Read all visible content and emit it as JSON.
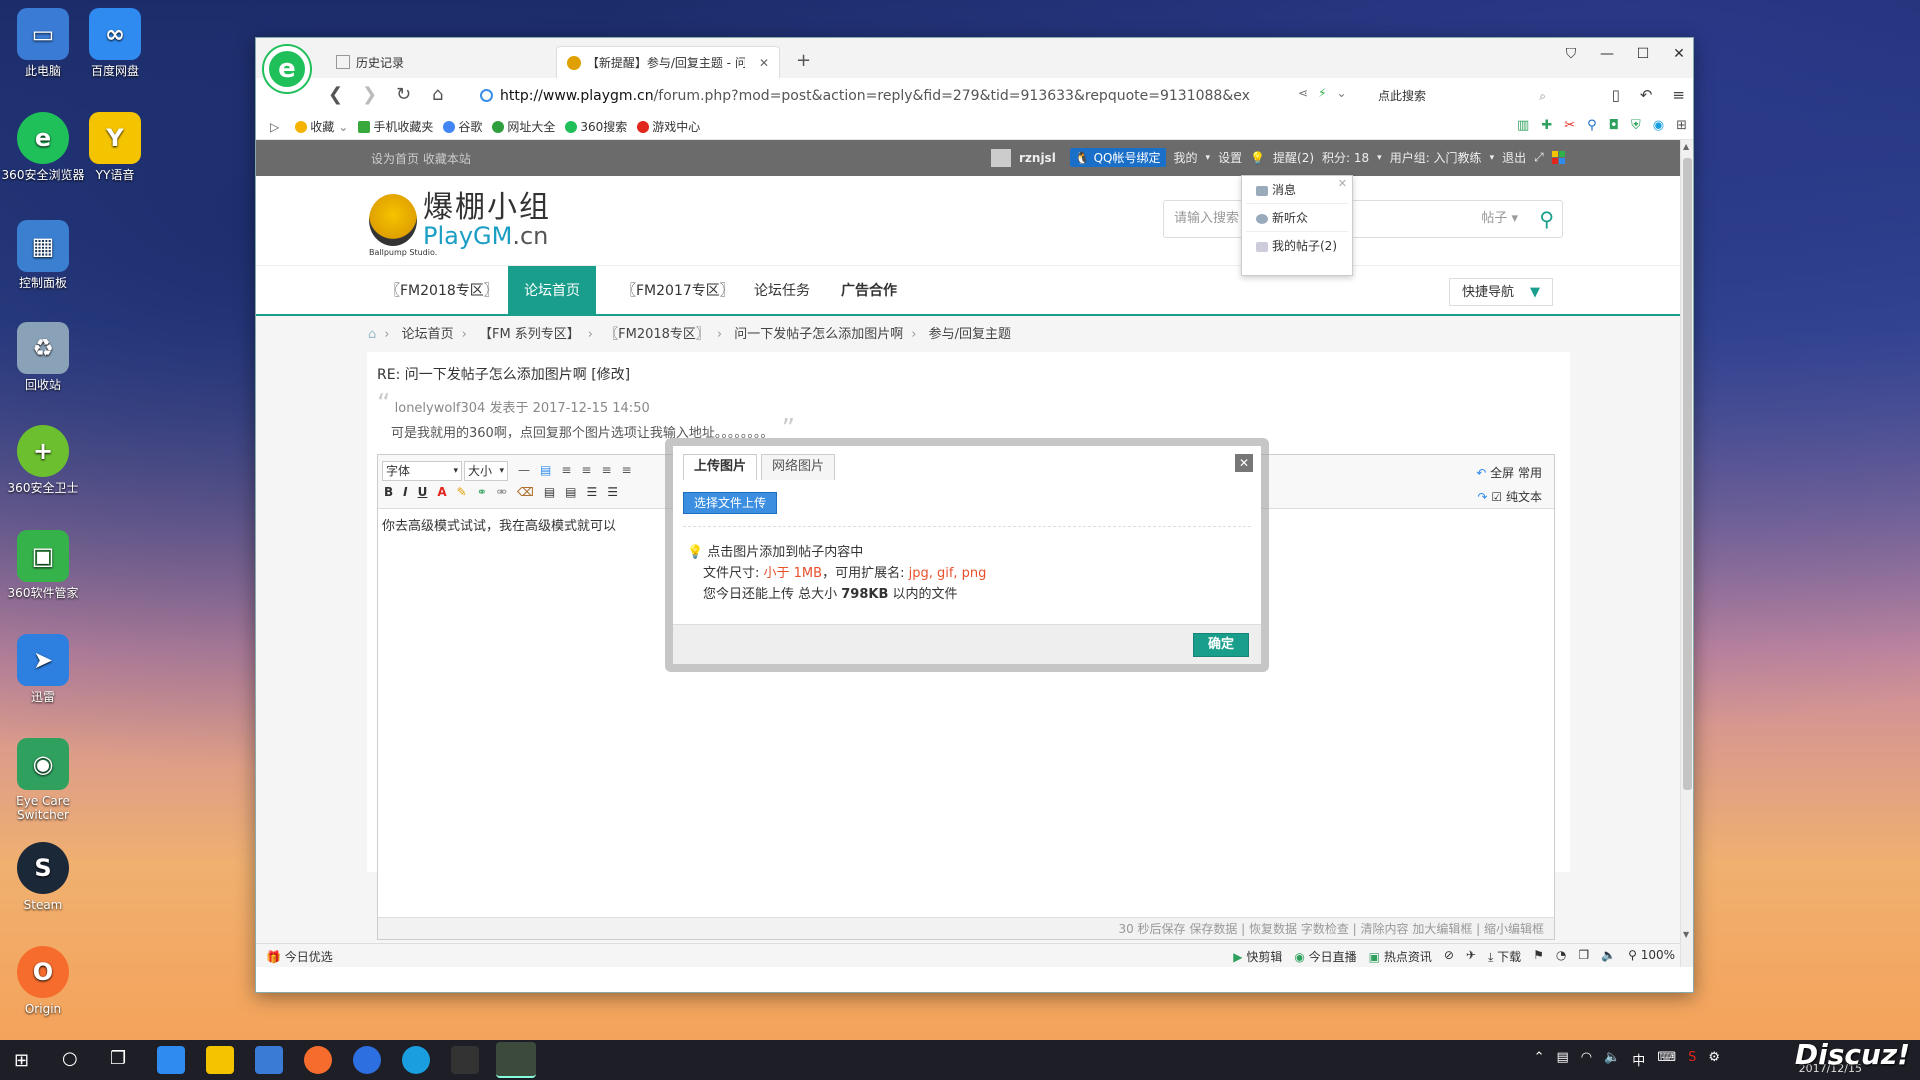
{
  "desktop": {
    "icons": [
      {
        "label": "此电脑",
        "color": "#3a7bd5",
        "glyph": "▭"
      },
      {
        "label": "百度网盘",
        "color": "#2f8bf0",
        "glyph": "∞"
      },
      {
        "label": "360安全浏览器",
        "color": "#1fbf5a",
        "glyph": "e"
      },
      {
        "label": "YY语音",
        "color": "#f5c400",
        "glyph": "Y"
      },
      {
        "label": "控制面板",
        "color": "#3b7fd0",
        "glyph": "▦"
      },
      {
        "label": "回收站",
        "color": "#8aa2b8",
        "glyph": "♻"
      },
      {
        "label": "360安全卫士",
        "color": "#6cc02f",
        "glyph": "+"
      },
      {
        "label": "360软件管家",
        "color": "#36b24a",
        "glyph": "▣"
      },
      {
        "label": "迅雷",
        "color": "#2d7fe0",
        "glyph": "➤"
      },
      {
        "label": "Eye Care Switcher",
        "color": "#2fa05e",
        "glyph": "◉"
      },
      {
        "label": "Steam",
        "color": "#1b2838",
        "glyph": "S"
      },
      {
        "label": "Origin",
        "color": "#f56c2d",
        "glyph": "O"
      }
    ]
  },
  "browser": {
    "tabs": [
      {
        "label": "历史记录"
      },
      {
        "label": "【新提醒】参与/回复主题 - 问···"
      }
    ],
    "url_host": "http://www.playgm.cn",
    "url_path": "/forum.php?mod=post&action=reply&fid=279&tid=913633&repquote=9131088&ex",
    "search_placeholder": "点此搜索",
    "favorites": [
      {
        "label": "收藏",
        "color": "#f5b300"
      },
      {
        "label": "手机收藏夹",
        "color": "#36a83c"
      },
      {
        "label": "谷歌",
        "color": "#4285f4"
      },
      {
        "label": "网址大全",
        "color": "#2e9f3c"
      },
      {
        "label": "360搜索",
        "color": "#1fbf5a"
      },
      {
        "label": "游戏中心",
        "color": "#e0261d"
      }
    ]
  },
  "site": {
    "toolbar_left": "设为首页  收藏本站",
    "username": "rznjsl",
    "qq_bind": "QQ帐号绑定",
    "toolbar_items": [
      "我的",
      "设置",
      "提醒(2)",
      "积分: 18",
      "用户组: 入门教练",
      "退出"
    ],
    "logo_cn": "爆棚小组",
    "logo_en_1": "PlayGM",
    "logo_en_2": ".cn",
    "logo_studio": "Ballpump Studio.",
    "search_placeholder": "请输入搜索",
    "search_type": "帖子",
    "nav": [
      "〖FM2018专区〗",
      "论坛首页",
      "〖FM2017专区〗",
      "论坛任务",
      "广告合作"
    ],
    "quick_nav": "快捷导航",
    "breadcrumb": [
      "论坛首页",
      "【FM 系列专区】",
      "〖FM2018专区〗",
      "问一下发帖子怎么添加图片啊",
      "参与/回复主题"
    ]
  },
  "dropdown": {
    "items": [
      "消息",
      "新听众",
      "我的帖子(2)"
    ]
  },
  "post": {
    "title": "RE: 问一下发帖子怎么添加图片啊 [修改]",
    "quote_meta": "lonelywolf304 发表于 2017-12-15 14:50",
    "quote_text": "可是我就用的360啊，点回复那个图片选项让我输入地址。。。。。。。。",
    "font_select": "字体",
    "size_select": "大小",
    "body": "你去高级模式试试，我在高级模式就可以",
    "right_tools_1": "全屏  常用",
    "right_tools_2": "纯文本",
    "footer": "30 秒后保存 保存数据 | 恢复数据    字数检查 | 清除内容    加大编辑框 | 缩小编辑框"
  },
  "modal": {
    "tabs": [
      "上传图片",
      "网络图片"
    ],
    "upload_button": "选择文件上传",
    "info_1": "点击图片添加到帖子内容中",
    "info_2_prefix": "文件尺寸: ",
    "info_2_size": "小于 1MB",
    "info_2_mid": "，可用扩展名: ",
    "info_2_ext": "jpg, gif, png",
    "info_3_prefix": "您今日还能上传 总大小 ",
    "info_3_size": "798KB",
    "info_3_suffix": " 以内的文件",
    "ok": "确定"
  },
  "statusbar": {
    "left": "今日优选",
    "right": [
      "快剪辑",
      "今日直播",
      "热点资讯",
      "下载",
      "100%"
    ]
  },
  "taskbar": {
    "tray": "中",
    "brand": "Discuz!",
    "date": "2017/12/15"
  }
}
